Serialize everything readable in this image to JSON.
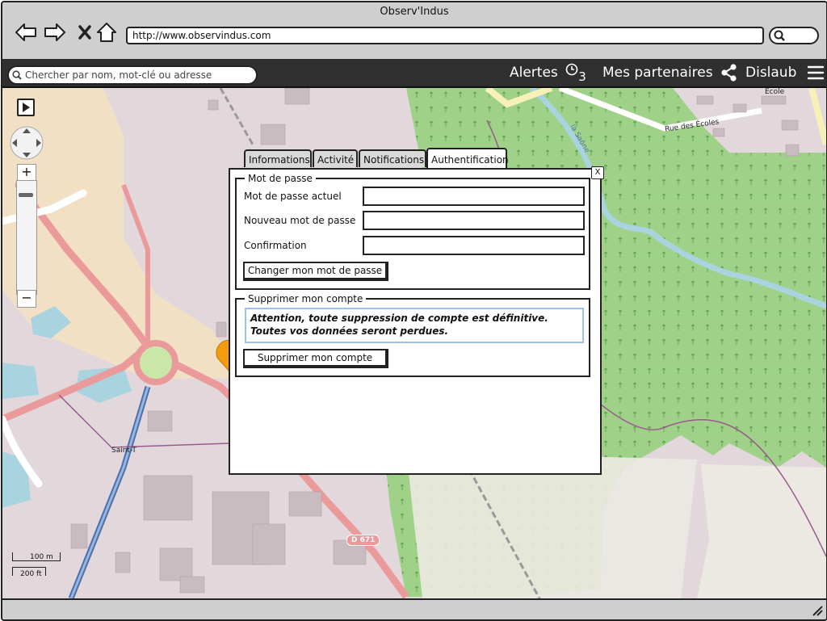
{
  "window": {
    "title": "Observ'Indus"
  },
  "browser": {
    "url": "http://www.observindus.com"
  },
  "appbar": {
    "search_placeholder": "Chercher par nom, mot-clé ou adresse",
    "alerts_label": "Alertes",
    "alerts_count": "3",
    "partners_label": "Mes partenaires",
    "user_label": "Dislaub"
  },
  "map": {
    "labels": {
      "rue_ecoles": "Rue des Écoles",
      "ecole": "École",
      "river": "la Saône",
      "saint_t": "Saint-T",
      "d671": "D 671"
    },
    "scale_metric": "100 m",
    "scale_imperial": "200 ft",
    "zoom_in": "+",
    "zoom_out": "−"
  },
  "tabs": [
    {
      "label": "Informations"
    },
    {
      "label": "Activité"
    },
    {
      "label": "Notifications"
    },
    {
      "label": "Authentification"
    }
  ],
  "active_tab": "Authentification",
  "dialog": {
    "close": "X",
    "password_group": {
      "legend": "Mot de passe",
      "current_label": "Mot de passe actuel",
      "new_label": "Nouveau mot de passe",
      "confirm_label": "Confirmation",
      "current_value": "",
      "new_value": "",
      "confirm_value": "",
      "submit": "Changer mon mot de passe"
    },
    "delete_group": {
      "legend": "Supprimer mon compte",
      "warning_line1": "Attention, toute suppression de compte est définitive.",
      "warning_line2": "Toutes vos données seront perdues.",
      "submit": "Supprimer mon compte"
    }
  },
  "colors": {
    "forest": "#9fd189",
    "residential": "#e2d8dc",
    "farmland": "#f1e0c3",
    "road_primary": "#eb9a9c",
    "water": "#a9d3df",
    "appbar": "#2f2f2f",
    "warning_border": "#9dc1e8"
  }
}
